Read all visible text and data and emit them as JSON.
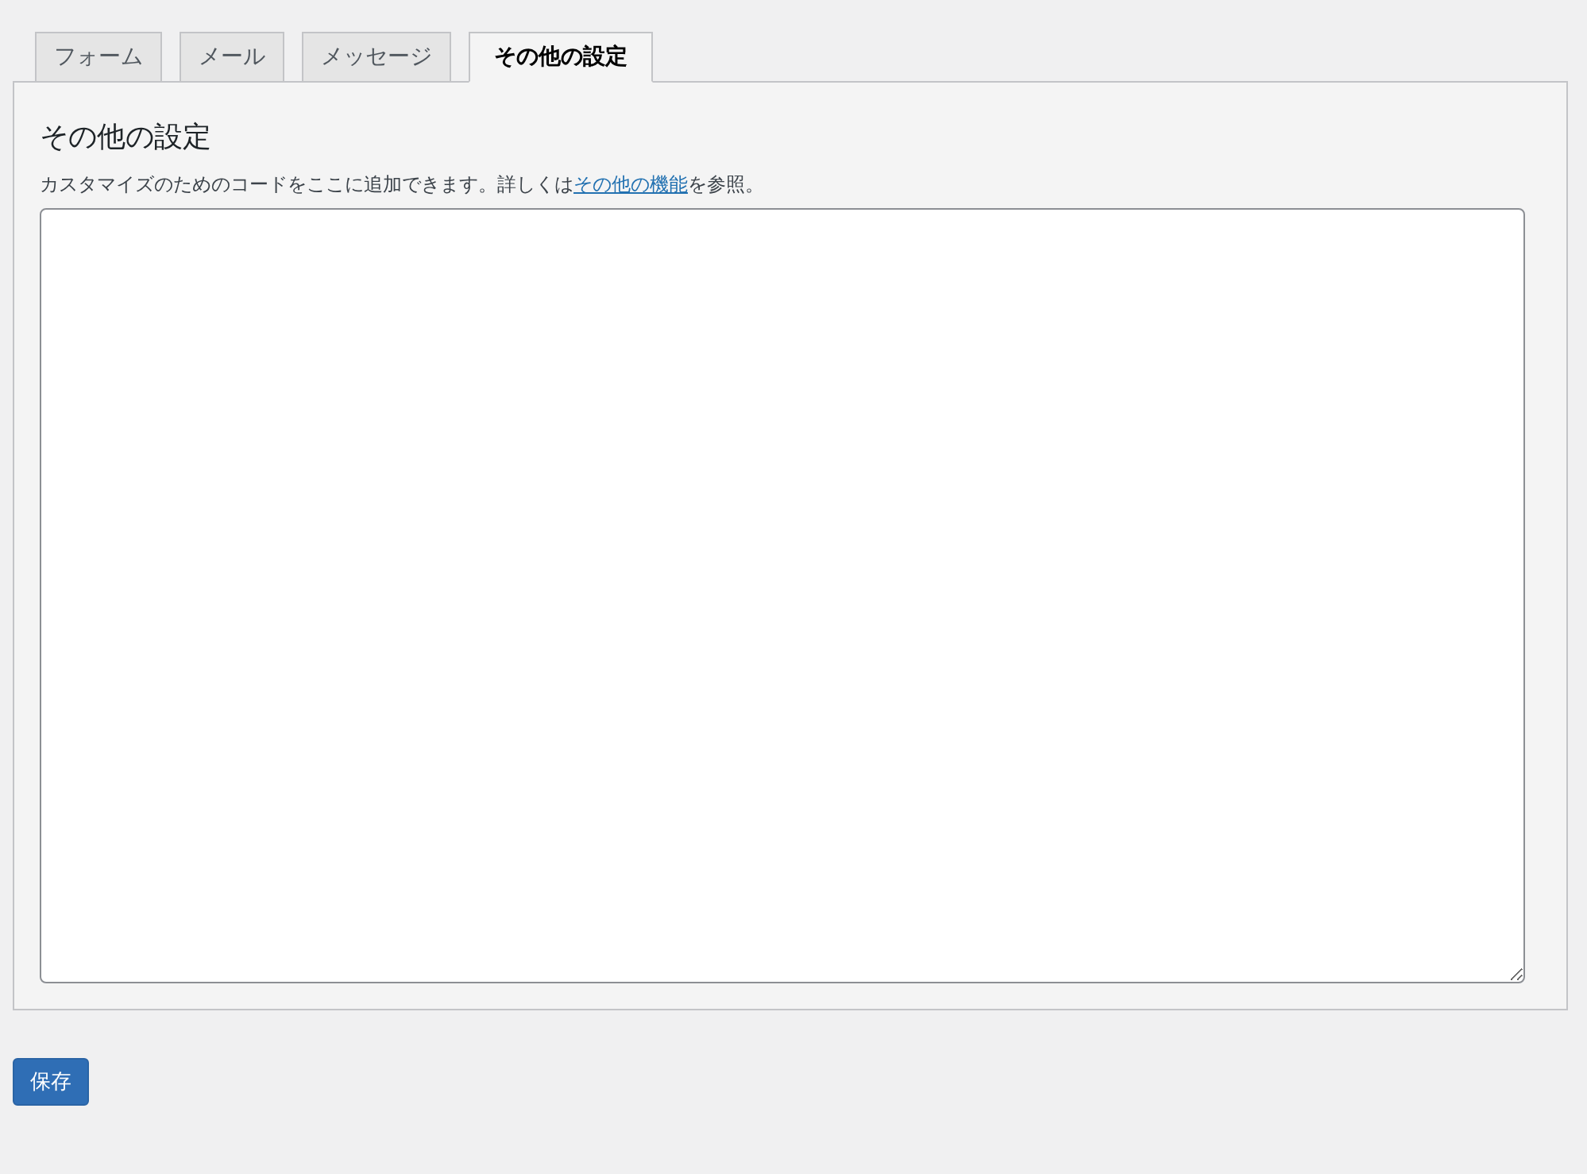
{
  "tabs": [
    {
      "label": "フォーム",
      "selected": false
    },
    {
      "label": "メール",
      "selected": false
    },
    {
      "label": "メッセージ",
      "selected": false
    },
    {
      "label": "その他の設定",
      "selected": true
    }
  ],
  "panel": {
    "heading": "その他の設定",
    "description": {
      "before": "カスタマイズのためのコードをここに追加できます。詳しくは",
      "link": "その他の機能",
      "after": "を参照。"
    }
  },
  "save_button": "保存"
}
